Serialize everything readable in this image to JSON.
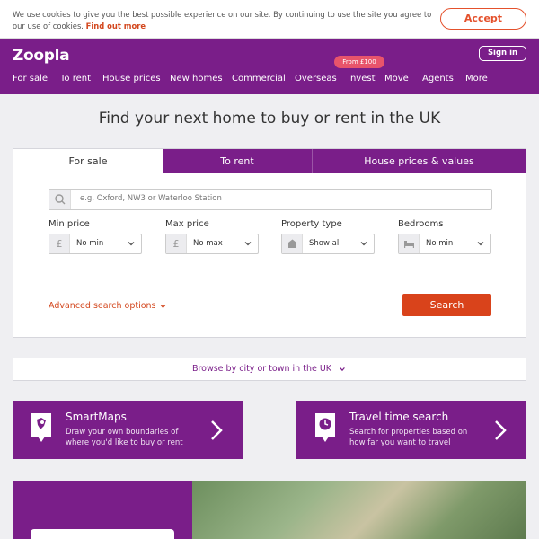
{
  "cookie": {
    "text": "We use cookies to give you the best possible experience on our site. By continuing to use the site you agree to our use of cookies.",
    "link": "Find out more",
    "accept": "Accept"
  },
  "header": {
    "logo": "Zoopla",
    "signin": "Sign in",
    "invest_badge": "From £100",
    "nav": [
      "For sale",
      "To rent",
      "House prices",
      "New homes",
      "Commercial",
      "Overseas",
      "Invest",
      "Move",
      "Agents",
      "More"
    ]
  },
  "hero": {
    "title": "Find your next home to buy or rent in the UK"
  },
  "search": {
    "tabs": [
      "For sale",
      "To rent",
      "House prices & values"
    ],
    "placeholder": "e.g. Oxford, NW3 or Waterloo Station",
    "fields": [
      {
        "label": "Min price",
        "value": "No min",
        "icon": "pound-icon"
      },
      {
        "label": "Max price",
        "value": "No max",
        "icon": "pound-icon"
      },
      {
        "label": "Property type",
        "value": "Show all",
        "icon": "house-icon"
      },
      {
        "label": "Bedrooms",
        "value": "No min",
        "icon": "bed-icon"
      }
    ],
    "advanced": "Advanced search options",
    "button": "Search"
  },
  "browse": {
    "label": "Browse by city or town in the UK"
  },
  "promos": [
    {
      "title": "SmartMaps",
      "desc": "Draw your own boundaries of where you'd like to buy or rent",
      "icon": "map-pin-icon"
    },
    {
      "title": "Travel time search",
      "desc": "Search for properties based on how far you want to travel",
      "icon": "clock-pin-icon"
    }
  ],
  "colors": {
    "brand": "#7a1e89",
    "accent": "#d9431b",
    "badge": "#e8546b"
  }
}
